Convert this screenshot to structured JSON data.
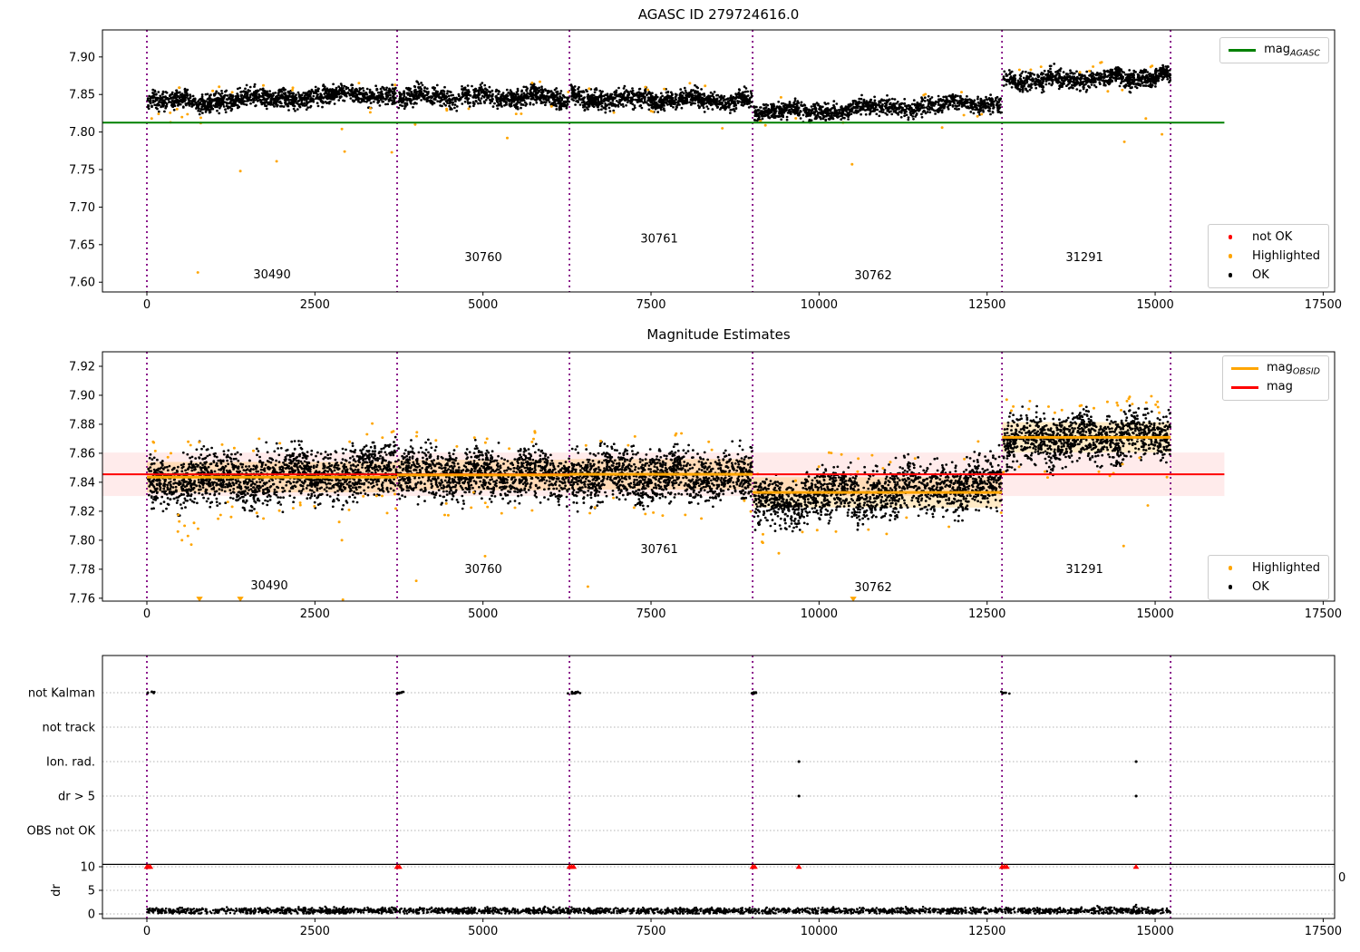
{
  "page": {
    "background": "#ffffff"
  },
  "colors": {
    "ok": "#000000",
    "highlighted": "#ffa500",
    "not_ok": "#ff0000",
    "mag_agasc": "#008000",
    "mag": "#ff0000",
    "mag_obsid": "#ffa500",
    "obsid_boundary": "#800080",
    "grid": "#b3b3b3",
    "band_mag": "rgba(255,0,0,0.08)",
    "band_obsid": "rgba(255,166,0,0.22)"
  },
  "legends": {
    "p1_line": {
      "label_main": "mag",
      "label_sub": "AGASC",
      "color": "#008000"
    },
    "p1_points": [
      {
        "label": "not OK",
        "color": "#ff0000"
      },
      {
        "label": "Highlighted",
        "color": "#ffa500"
      },
      {
        "label": "OK",
        "color": "#000000"
      }
    ],
    "p2_lines": [
      {
        "label_main": "mag",
        "label_sub": "OBSID",
        "color": "#ffa500"
      },
      {
        "label_main": "mag",
        "label_sub": "",
        "color": "#ff0000"
      }
    ],
    "p2_points": [
      {
        "label": "Highlighted",
        "color": "#ffa500"
      },
      {
        "label": "OK",
        "color": "#000000"
      }
    ]
  },
  "chart_data": [
    {
      "id": "agasc_mag",
      "type": "scatter",
      "title": "AGASC ID 279724616.0",
      "xlim": [
        -661,
        17670
      ],
      "ylim": [
        7.587,
        7.936
      ],
      "xticks": [
        0,
        2500,
        5000,
        7500,
        10000,
        12500,
        15000,
        17500
      ],
      "yticks": [
        "7.60",
        "7.65",
        "7.70",
        "7.75",
        "7.80",
        "7.85",
        "7.90"
      ],
      "mag_agasc": 7.8125,
      "line_span": [
        -661,
        16030
      ],
      "obsid_boundaries": [
        0,
        3723,
        6287,
        9012,
        12722,
        15230
      ],
      "obsids": [
        {
          "obsid": "30490",
          "x0": 10,
          "x1": 3710,
          "mag0": 7.839,
          "mag1": 7.851,
          "sigma": 0.006,
          "n": 1300,
          "n_highlighted": 16,
          "label_x": 1862,
          "label_y": 7.605
        },
        {
          "obsid": "30760",
          "x0": 3740,
          "x1": 6280,
          "mag0": 7.8475,
          "mag1": 7.8455,
          "sigma": 0.006,
          "n": 850,
          "n_highlighted": 9,
          "label_x": 5005,
          "label_y": 7.628
        },
        {
          "obsid": "30761",
          "x0": 6300,
          "x1": 9000,
          "mag0": 7.845,
          "mag1": 7.842,
          "sigma": 0.006,
          "n": 950,
          "n_highlighted": 9,
          "label_x": 7622,
          "label_y": 7.653
        },
        {
          "obsid": "30762",
          "x0": 9030,
          "x1": 12715,
          "mag0": 7.825,
          "mag1": 7.839,
          "sigma": 0.0055,
          "n": 1150,
          "n_highlighted": 10,
          "label_x": 10805,
          "label_y": 7.604
        },
        {
          "obsid": "31291",
          "x0": 12740,
          "x1": 15225,
          "mag0": 7.868,
          "mag1": 7.8735,
          "sigma": 0.0058,
          "n": 850,
          "n_highlighted": 12,
          "label_x": 13948,
          "label_y": 7.628
        }
      ],
      "highlighted_outliers": [
        [
          756,
          7.613
        ],
        [
          70,
          7.818
        ],
        [
          350,
          7.813
        ],
        [
          520,
          7.82
        ],
        [
          800,
          7.812
        ],
        [
          1389,
          7.748
        ],
        [
          1929,
          7.761
        ],
        [
          2900,
          7.804
        ],
        [
          2941,
          7.774
        ],
        [
          3642,
          7.773
        ],
        [
          3990,
          7.81
        ],
        [
          5360,
          7.792
        ],
        [
          8560,
          7.805
        ],
        [
          9200,
          7.809
        ],
        [
          10490,
          7.757
        ],
        [
          11830,
          7.806
        ],
        [
          14540,
          7.787
        ],
        [
          14860,
          7.818
        ],
        [
          15100,
          7.797
        ]
      ]
    },
    {
      "id": "mag_estimates",
      "type": "scatter",
      "title": "Magnitude Estimates",
      "xlim": [
        -661,
        17670
      ],
      "ylim": [
        7.758,
        7.93
      ],
      "xticks": [
        0,
        2500,
        5000,
        7500,
        10000,
        12500,
        15000,
        17500
      ],
      "yticks": [
        "7.76",
        "7.78",
        "7.80",
        "7.82",
        "7.84",
        "7.86",
        "7.88",
        "7.90",
        "7.92"
      ],
      "mag": 7.8455,
      "mag_band": [
        7.8305,
        7.8605
      ],
      "line_span": [
        -661,
        16030
      ],
      "obsid_band_halfwidth": 0.0105,
      "obsid_boundaries": [
        0,
        3723,
        6287,
        9012,
        12722,
        15230
      ],
      "obsids": [
        {
          "obsid": "30490",
          "x0": 10,
          "x1": 3710,
          "mag_obsid": 7.8435,
          "band_x0": 0,
          "band_x1": 3723,
          "mag0": 7.84,
          "mag1": 7.848,
          "sigma": 0.009,
          "n": 1700,
          "n_highlighted": 40,
          "label_x": 1821,
          "label_y": 7.766
        },
        {
          "obsid": "30760",
          "x0": 3740,
          "x1": 6280,
          "mag_obsid": 7.845,
          "band_x0": 3723,
          "band_x1": 6287,
          "mag0": 7.846,
          "mag1": 7.845,
          "sigma": 0.0085,
          "n": 1100,
          "n_highlighted": 22,
          "label_x": 5005,
          "label_y": 7.7775
        },
        {
          "obsid": "30761",
          "x0": 6300,
          "x1": 9000,
          "mag_obsid": 7.8455,
          "band_x0": 6287,
          "band_x1": 9012,
          "mag0": 7.8455,
          "mag1": 7.844,
          "sigma": 0.0085,
          "n": 1200,
          "n_highlighted": 20,
          "label_x": 7622,
          "label_y": 7.791
        },
        {
          "obsid": "30762",
          "x0": 9030,
          "x1": 12715,
          "mag_obsid": 7.833,
          "band_x0": 9012,
          "band_x1": 12722,
          "mag0": 7.826,
          "mag1": 7.84,
          "sigma": 0.0085,
          "n": 1500,
          "n_highlighted": 24,
          "label_x": 10805,
          "label_y": 7.765
        },
        {
          "obsid": "31291",
          "x0": 12740,
          "x1": 15225,
          "mag_obsid": 7.871,
          "band_x0": 12722,
          "band_x1": 15230,
          "mag0": 7.868,
          "mag1": 7.873,
          "sigma": 0.008,
          "n": 1100,
          "n_highlighted": 30,
          "label_x": 13948,
          "label_y": 7.7775
        }
      ],
      "highlighted_outliers": [
        [
          460,
          7.806
        ],
        [
          520,
          7.8
        ],
        [
          560,
          7.81
        ],
        [
          610,
          7.803
        ],
        [
          660,
          7.797
        ],
        [
          700,
          7.812
        ],
        [
          480,
          7.813
        ],
        [
          760,
          7.808
        ],
        [
          2900,
          7.8
        ],
        [
          2915,
          7.759
        ],
        [
          4006,
          7.772
        ],
        [
          5030,
          7.789
        ],
        [
          6560,
          7.768
        ],
        [
          9400,
          7.791
        ],
        [
          10250,
          7.806
        ],
        [
          12790,
          7.897
        ],
        [
          14530,
          7.796
        ],
        [
          14580,
          7.896
        ],
        [
          14620,
          7.899
        ],
        [
          14660,
          7.894
        ],
        [
          14890,
          7.824
        ],
        [
          15060,
          7.888
        ]
      ],
      "clipped_low_x": [
        783,
        1390,
        10509
      ]
    },
    {
      "id": "flags",
      "type": "scatter",
      "title": "",
      "xlim": [
        -661,
        17670
      ],
      "xticks": [
        0,
        2500,
        5000,
        7500,
        10000,
        12500,
        15000,
        17500
      ],
      "flag_rows": [
        "not Kalman",
        "not track",
        "Ion. rad.",
        "dr > 5",
        "OBS not OK"
      ],
      "not_kalman_clusters": [
        [
          0,
          115
        ],
        [
          3710,
          3830
        ],
        [
          6250,
          6455
        ],
        [
          8990,
          9075
        ],
        [
          12695,
          12835
        ]
      ],
      "not_track_x": [],
      "ion_rad_x": [
        9700,
        14716
      ],
      "dr_gt5_x": [
        9700,
        14716
      ],
      "obs_not_ok_x": [],
      "dr_axis": {
        "label": "dr",
        "ticks": [
          0,
          5,
          10
        ],
        "hline": 10.5
      },
      "dr_not_ok_x": [
        0,
        22,
        50,
        3723,
        3756,
        6287,
        6318,
        6349,
        9012,
        9043,
        9700,
        12722,
        12757,
        12792,
        14716
      ],
      "dr_band": {
        "x0": 0,
        "x1": 15230,
        "mean": 0.65,
        "sigma": 0.32,
        "n": 2400
      },
      "dr_spikes": [
        [
          14140,
          1.7
        ],
        [
          14170,
          1.45
        ],
        [
          14700,
          1.6
        ],
        [
          14716,
          1.95
        ]
      ],
      "obsid_boundaries": [
        0,
        3723,
        6287,
        9012,
        12722,
        15230
      ],
      "right_axis_label": "0"
    }
  ]
}
